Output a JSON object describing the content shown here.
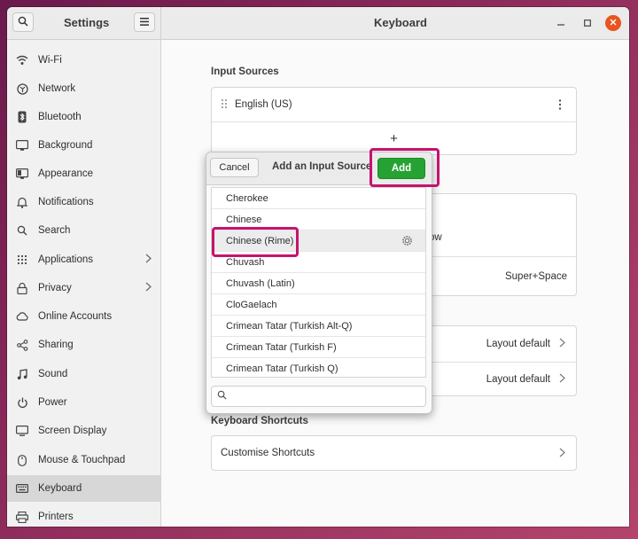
{
  "window": {
    "sidebar_title": "Settings",
    "page_title": "Keyboard",
    "controls": {
      "minimize": "–",
      "maximize": "□",
      "close": "✕"
    }
  },
  "sidebar": {
    "items": [
      {
        "label": "Wi-Fi",
        "icon": "wifi-icon"
      },
      {
        "label": "Network",
        "icon": "network-icon"
      },
      {
        "label": "Bluetooth",
        "icon": "bluetooth-icon"
      },
      {
        "label": "Background",
        "icon": "background-icon"
      },
      {
        "label": "Appearance",
        "icon": "appearance-icon"
      },
      {
        "label": "Notifications",
        "icon": "bell-icon"
      },
      {
        "label": "Search",
        "icon": "search-icon"
      },
      {
        "label": "Applications",
        "icon": "grid-icon"
      },
      {
        "label": "Privacy",
        "icon": "lock-icon"
      },
      {
        "label": "Online Accounts",
        "icon": "cloud-icon"
      },
      {
        "label": "Sharing",
        "icon": "share-icon"
      },
      {
        "label": "Sound",
        "icon": "music-note-icon"
      },
      {
        "label": "Power",
        "icon": "power-icon"
      },
      {
        "label": "Screen Display",
        "icon": "display-icon"
      },
      {
        "label": "Mouse & Touchpad",
        "icon": "mouse-icon"
      },
      {
        "label": "Keyboard",
        "icon": "keyboard-icon"
      },
      {
        "label": "Printers",
        "icon": "printer-icon"
      }
    ],
    "active": "Keyboard"
  },
  "main": {
    "input_sources_title": "Input Sources",
    "input_source": "English (US)",
    "add_symbol": "+",
    "switch_row_partial": "ow",
    "shortcut_value": "Super+Space",
    "layout_default_1": "Layout default",
    "layout_default_2": "Layout default",
    "keyboard_shortcuts_title": "Keyboard Shortcuts",
    "customise_shortcuts": "Customise Shortcuts"
  },
  "dialog": {
    "cancel_label": "Cancel",
    "title": "Add an Input Source",
    "add_label": "Add",
    "items": [
      "Cherokee",
      "Chinese",
      "Chinese (Rime)",
      "Chuvash",
      "Chuvash (Latin)",
      "CloGaelach",
      "Crimean Tatar (Turkish Alt-Q)",
      "Crimean Tatar (Turkish F)",
      "Crimean Tatar (Turkish Q)"
    ],
    "selected": "Chinese (Rime)",
    "search_value": ""
  },
  "colors": {
    "accent_add": "#26a233",
    "highlight": "#c6136e",
    "close_button": "#e95420"
  }
}
